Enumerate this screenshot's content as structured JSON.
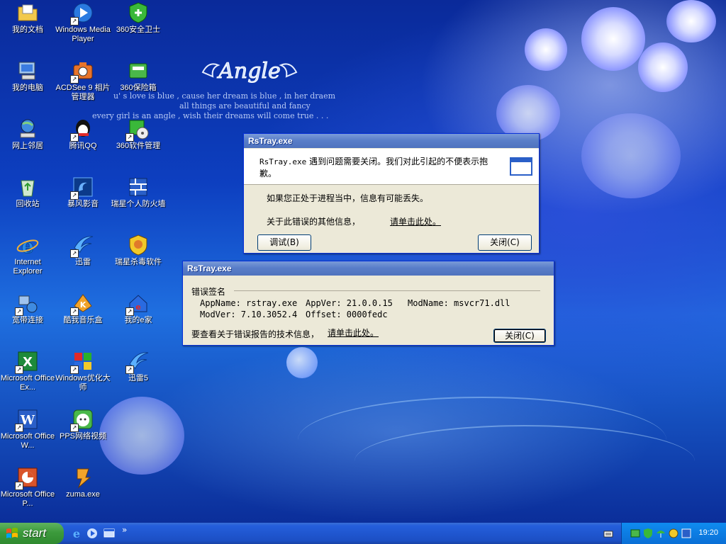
{
  "desktop": {
    "wallpaper_logo": "Angle",
    "poem_lines": [
      "u' s love is blue , cause her dream is blue , in her draem",
      "all things are beautiful and fancy",
      "every girl is an angle , wish their dreams will come true . . ."
    ],
    "icons": [
      {
        "label": "我的文档",
        "icon": "my-documents-icon",
        "shortcut": false
      },
      {
        "label": "我的电脑",
        "icon": "my-computer-icon",
        "shortcut": false
      },
      {
        "label": "网上邻居",
        "icon": "network-places-icon",
        "shortcut": false
      },
      {
        "label": "回收站",
        "icon": "recycle-bin-icon",
        "shortcut": false
      },
      {
        "label": "Internet Explorer",
        "icon": "internet-explorer-icon",
        "shortcut": false
      },
      {
        "label": "宽带连接",
        "icon": "broadband-connection-icon",
        "shortcut": true
      },
      {
        "label": "Microsoft Office Ex...",
        "icon": "excel-icon",
        "shortcut": true
      },
      {
        "label": "Microsoft Office W...",
        "icon": "word-icon",
        "shortcut": true
      },
      {
        "label": "Microsoft Office P...",
        "icon": "powerpoint-icon",
        "shortcut": true
      },
      {
        "label": "Windows Media Player",
        "icon": "media-player-icon",
        "shortcut": true
      },
      {
        "label": "ACDSee 9 相片管理器",
        "icon": "acdsee-icon",
        "shortcut": true
      },
      {
        "label": "腾讯QQ",
        "icon": "qq-icon",
        "shortcut": true
      },
      {
        "label": "暴风影音",
        "icon": "storm-player-icon",
        "shortcut": true
      },
      {
        "label": "迅雷",
        "icon": "thunder-icon",
        "shortcut": true
      },
      {
        "label": "酷我音乐盒",
        "icon": "kuwo-music-icon",
        "shortcut": true
      },
      {
        "label": "Windows优化大师",
        "icon": "windows-optimizer-icon",
        "shortcut": true
      },
      {
        "label": "PPS网络视频",
        "icon": "pps-video-icon",
        "shortcut": true
      },
      {
        "label": "zuma.exe",
        "icon": "zuma-icon",
        "shortcut": false
      },
      {
        "label": "360安全卫士",
        "icon": "360-safe-icon",
        "shortcut": false
      },
      {
        "label": "360保险箱",
        "icon": "360-safebox-icon",
        "shortcut": false
      },
      {
        "label": "360软件管理",
        "icon": "360-software-icon",
        "shortcut": true
      },
      {
        "label": "瑞星个人防火墙",
        "icon": "rising-firewall-icon",
        "shortcut": false
      },
      {
        "label": "瑞星杀毒软件",
        "icon": "rising-antivirus-icon",
        "shortcut": false
      },
      {
        "label": "我的e家",
        "icon": "my-ehome-icon",
        "shortcut": true
      },
      {
        "label": "迅雷5",
        "icon": "thunder5-icon",
        "shortcut": true
      }
    ]
  },
  "dialog_main": {
    "title": "RsTray.exe",
    "message_prefix": "RsTray.exe",
    "message": "遇到问题需要关闭。我们对此引起的不便表示抱歉。",
    "info_lost": "如果您正处于进程当中，信息有可能丢失。",
    "more_info": "关于此错误的其他信息，",
    "link": "请单击此处。",
    "debug_button": "调试(B)",
    "close_button": "关闭(C)"
  },
  "dialog_details": {
    "title": "RsTray.exe",
    "section_title": "错误签名",
    "appname": "AppName: rstray.exe",
    "appver": "AppVer: 21.0.0.15",
    "modname": "ModName: msvcr71.dll",
    "modver": "ModVer: 7.10.3052.4",
    "offset": "Offset: 0000fedc",
    "tech_info": "要查看关于错误报告的技术信息，",
    "link": "请单击此处。",
    "close_button": "关闭(C)"
  },
  "taskbar": {
    "start_label": "start",
    "quicklaunch_overflow": "»",
    "clock": "19:20"
  },
  "colors": {
    "taskbar": "#245edb",
    "start": "#3c9a3c",
    "title_inactive": "#5a7ec9",
    "link": "#0000ee"
  }
}
